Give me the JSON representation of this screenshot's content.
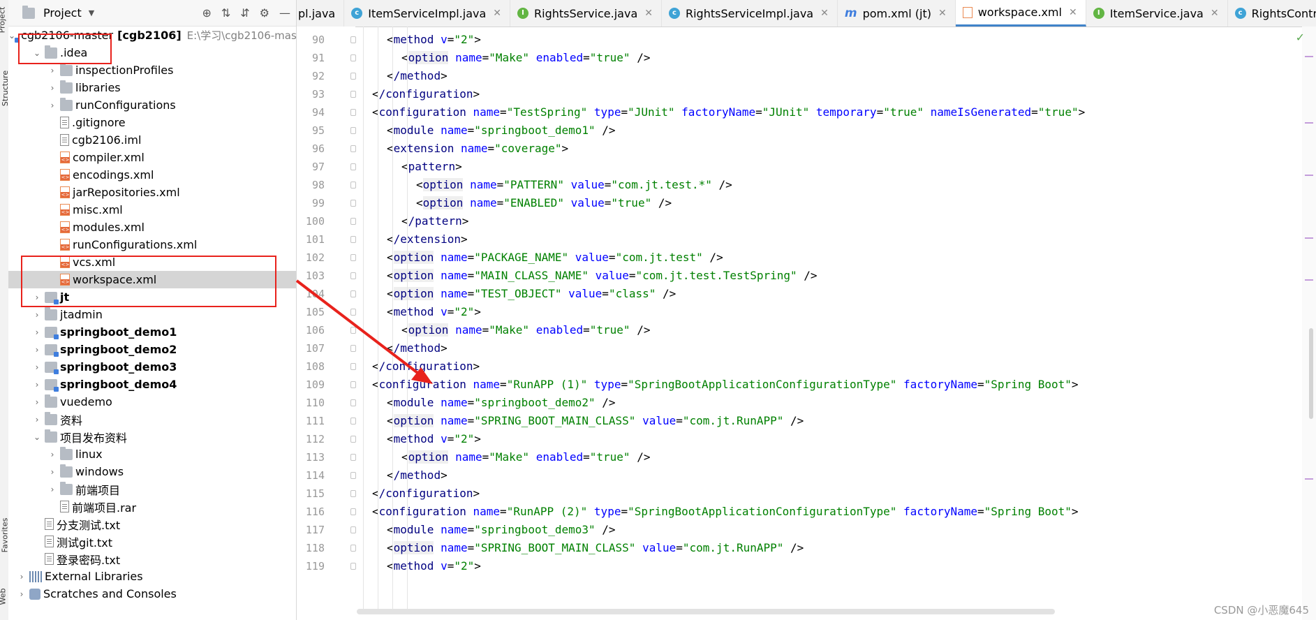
{
  "side_strip": {
    "labels": [
      "Project",
      "Structure",
      "Favorites",
      "Web"
    ]
  },
  "project_panel": {
    "title": "Project",
    "tree": [
      {
        "label": "cgb2106-master",
        "bold_suffix": "[cgb2106]",
        "path": "E:\\学习\\cgb2106-mas",
        "icon": "module",
        "indent": 0,
        "expanded": true
      },
      {
        "label": ".idea",
        "icon": "folder",
        "indent": 1,
        "expanded": true
      },
      {
        "label": "inspectionProfiles",
        "icon": "folder",
        "indent": 2,
        "expanded": false
      },
      {
        "label": "libraries",
        "icon": "folder",
        "indent": 2,
        "expanded": false
      },
      {
        "label": "runConfigurations",
        "icon": "folder",
        "indent": 2,
        "expanded": false
      },
      {
        "label": ".gitignore",
        "icon": "file",
        "indent": 2
      },
      {
        "label": "cgb2106.iml",
        "icon": "file",
        "indent": 2
      },
      {
        "label": "compiler.xml",
        "icon": "xml",
        "indent": 2
      },
      {
        "label": "encodings.xml",
        "icon": "xml",
        "indent": 2
      },
      {
        "label": "jarRepositories.xml",
        "icon": "xml",
        "indent": 2
      },
      {
        "label": "misc.xml",
        "icon": "xml",
        "indent": 2
      },
      {
        "label": "modules.xml",
        "icon": "xml",
        "indent": 2
      },
      {
        "label": "runConfigurations.xml",
        "icon": "xml",
        "indent": 2
      },
      {
        "label": "vcs.xml",
        "icon": "xml",
        "indent": 2
      },
      {
        "label": "workspace.xml",
        "icon": "xml",
        "indent": 2,
        "selected": true
      },
      {
        "label": "jt",
        "icon": "module",
        "indent": 1,
        "expanded": false,
        "bold": true
      },
      {
        "label": "jtadmin",
        "icon": "folder",
        "indent": 1,
        "expanded": false
      },
      {
        "label": "springboot_demo1",
        "icon": "module",
        "indent": 1,
        "expanded": false,
        "bold": true
      },
      {
        "label": "springboot_demo2",
        "icon": "module",
        "indent": 1,
        "expanded": false,
        "bold": true
      },
      {
        "label": "springboot_demo3",
        "icon": "module",
        "indent": 1,
        "expanded": false,
        "bold": true
      },
      {
        "label": "springboot_demo4",
        "icon": "module",
        "indent": 1,
        "expanded": false,
        "bold": true
      },
      {
        "label": "vuedemo",
        "icon": "folder",
        "indent": 1,
        "expanded": false
      },
      {
        "label": "资料",
        "icon": "folder",
        "indent": 1,
        "expanded": false
      },
      {
        "label": "项目发布资料",
        "icon": "folder",
        "indent": 1,
        "expanded": true
      },
      {
        "label": "linux",
        "icon": "folder",
        "indent": 2,
        "expanded": false
      },
      {
        "label": "windows",
        "icon": "folder",
        "indent": 2,
        "expanded": false
      },
      {
        "label": "前端项目",
        "icon": "folder",
        "indent": 2,
        "expanded": false
      },
      {
        "label": "前端项目.rar",
        "icon": "file",
        "indent": 2
      },
      {
        "label": "分支测试.txt",
        "icon": "file",
        "indent": 1
      },
      {
        "label": "测试git.txt",
        "icon": "file",
        "indent": 1
      },
      {
        "label": "登录密码.txt",
        "icon": "file",
        "indent": 1
      },
      {
        "label": "External Libraries",
        "icon": "lib",
        "indent": 0,
        "expanded": false
      },
      {
        "label": "Scratches and Consoles",
        "icon": "scratch",
        "indent": 0,
        "expanded": false
      }
    ]
  },
  "tabs": [
    {
      "label": "pl.java",
      "icon": "none"
    },
    {
      "label": "ItemServiceImpl.java",
      "icon": "class",
      "close": true
    },
    {
      "label": "RightsService.java",
      "icon": "interface",
      "close": true
    },
    {
      "label": "RightsServiceImpl.java",
      "icon": "class",
      "close": true
    },
    {
      "label": "pom.xml (jt)",
      "icon": "maven",
      "close": true
    },
    {
      "label": "workspace.xml",
      "icon": "xml",
      "close": true,
      "active": true
    },
    {
      "label": "ItemService.java",
      "icon": "interface",
      "close": true
    },
    {
      "label": "RightsController.java",
      "icon": "class"
    }
  ],
  "code": [
    {
      "n": "90",
      "indent": 3,
      "tag": "method",
      "attrs": [
        [
          "v",
          "\"2\""
        ]
      ],
      "close": ">"
    },
    {
      "n": "91",
      "indent": 4,
      "tag": "option",
      "attrs": [
        [
          "name",
          "\"Make\""
        ],
        [
          "enabled",
          "\"true\""
        ]
      ],
      "close": " />"
    },
    {
      "n": "92",
      "indent": 3,
      "tag": "/method",
      "attrs": [],
      "close": ">"
    },
    {
      "n": "93",
      "indent": 2,
      "tag": "/configuration",
      "attrs": [],
      "close": ">"
    },
    {
      "n": "94",
      "indent": 2,
      "tag": "configuration",
      "attrs": [
        [
          "name",
          "\"TestSpring\""
        ],
        [
          "type",
          "\"JUnit\""
        ],
        [
          "factoryName",
          "\"JUnit\""
        ],
        [
          "temporary",
          "\"true\""
        ],
        [
          "nameIsGenerated",
          "\"true\""
        ]
      ],
      "close": ">"
    },
    {
      "n": "95",
      "indent": 3,
      "tag": "module",
      "attrs": [
        [
          "name",
          "\"springboot_demo1\""
        ]
      ],
      "close": " />"
    },
    {
      "n": "96",
      "indent": 3,
      "tag": "extension",
      "attrs": [
        [
          "name",
          "\"coverage\""
        ]
      ],
      "close": ">"
    },
    {
      "n": "97",
      "indent": 4,
      "tag": "pattern",
      "attrs": [],
      "close": ">"
    },
    {
      "n": "98",
      "indent": 5,
      "tag": "option",
      "attrs": [
        [
          "name",
          "\"PATTERN\""
        ],
        [
          "value",
          "\"com.jt.test.*\""
        ]
      ],
      "close": " />"
    },
    {
      "n": "99",
      "indent": 5,
      "tag": "option",
      "attrs": [
        [
          "name",
          "\"ENABLED\""
        ],
        [
          "value",
          "\"true\""
        ]
      ],
      "close": " />"
    },
    {
      "n": "100",
      "indent": 4,
      "tag": "/pattern",
      "attrs": [],
      "close": ">"
    },
    {
      "n": "101",
      "indent": 3,
      "tag": "/extension",
      "attrs": [],
      "close": ">"
    },
    {
      "n": "102",
      "indent": 3,
      "tag": "option",
      "attrs": [
        [
          "name",
          "\"PACKAGE_NAME\""
        ],
        [
          "value",
          "\"com.jt.test\""
        ]
      ],
      "close": " />"
    },
    {
      "n": "103",
      "indent": 3,
      "tag": "option",
      "attrs": [
        [
          "name",
          "\"MAIN_CLASS_NAME\""
        ],
        [
          "value",
          "\"com.jt.test.TestSpring\""
        ]
      ],
      "close": " />"
    },
    {
      "n": "104",
      "indent": 3,
      "tag": "option",
      "attrs": [
        [
          "name",
          "\"TEST_OBJECT\""
        ],
        [
          "value",
          "\"class\""
        ]
      ],
      "close": " />"
    },
    {
      "n": "105",
      "indent": 3,
      "tag": "method",
      "attrs": [
        [
          "v",
          "\"2\""
        ]
      ],
      "close": ">"
    },
    {
      "n": "106",
      "indent": 4,
      "tag": "option",
      "attrs": [
        [
          "name",
          "\"Make\""
        ],
        [
          "enabled",
          "\"true\""
        ]
      ],
      "close": " />"
    },
    {
      "n": "107",
      "indent": 3,
      "tag": "/method",
      "attrs": [],
      "close": ">"
    },
    {
      "n": "108",
      "indent": 2,
      "tag": "/configuration",
      "attrs": [],
      "close": ">"
    },
    {
      "n": "109",
      "indent": 2,
      "tag": "configuration",
      "attrs": [
        [
          "name",
          "\"RunAPP (1)\""
        ],
        [
          "type",
          "\"SpringBootApplicationConfigurationType\""
        ],
        [
          "factoryName",
          "\"Spring Boot\""
        ]
      ],
      "close": ">"
    },
    {
      "n": "110",
      "indent": 3,
      "tag": "module",
      "attrs": [
        [
          "name",
          "\"springboot_demo2\""
        ]
      ],
      "close": " />"
    },
    {
      "n": "111",
      "indent": 3,
      "tag": "option",
      "attrs": [
        [
          "name",
          "\"SPRING_BOOT_MAIN_CLASS\""
        ],
        [
          "value",
          "\"com.jt.RunAPP\""
        ]
      ],
      "close": " />"
    },
    {
      "n": "112",
      "indent": 3,
      "tag": "method",
      "attrs": [
        [
          "v",
          "\"2\""
        ]
      ],
      "close": ">"
    },
    {
      "n": "113",
      "indent": 4,
      "tag": "option",
      "attrs": [
        [
          "name",
          "\"Make\""
        ],
        [
          "enabled",
          "\"true\""
        ]
      ],
      "close": " />"
    },
    {
      "n": "114",
      "indent": 3,
      "tag": "/method",
      "attrs": [],
      "close": ">"
    },
    {
      "n": "115",
      "indent": 2,
      "tag": "/configuration",
      "attrs": [],
      "close": ">"
    },
    {
      "n": "116",
      "indent": 2,
      "tag": "configuration",
      "attrs": [
        [
          "name",
          "\"RunAPP (2)\""
        ],
        [
          "type",
          "\"SpringBootApplicationConfigurationType\""
        ],
        [
          "factoryName",
          "\"Spring Boot\""
        ]
      ],
      "close": ">"
    },
    {
      "n": "117",
      "indent": 3,
      "tag": "module",
      "attrs": [
        [
          "name",
          "\"springboot_demo3\""
        ]
      ],
      "close": " />"
    },
    {
      "n": "118",
      "indent": 3,
      "tag": "option",
      "attrs": [
        [
          "name",
          "\"SPRING_BOOT_MAIN_CLASS\""
        ],
        [
          "value",
          "\"com.jt.RunAPP\""
        ]
      ],
      "close": " />"
    },
    {
      "n": "119",
      "indent": 3,
      "tag": "method",
      "attrs": [
        [
          "v",
          "\"2\""
        ]
      ],
      "close": ">"
    }
  ],
  "watermark": "CSDN @小恶魔645",
  "colors": {
    "annotation": "#e8221c",
    "tag": "#000080",
    "attr": "#0000ff",
    "value": "#008000",
    "selection": "#d5d5d5",
    "active_tab": "#4083c9"
  }
}
